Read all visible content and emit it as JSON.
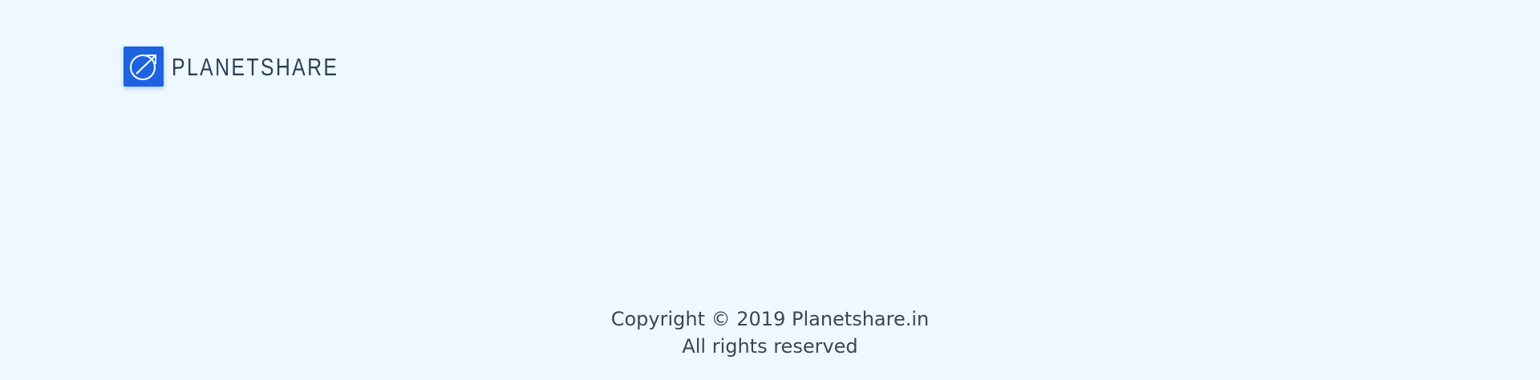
{
  "header": {
    "logo_icon": "share-arrow-icon",
    "brand_name": "PLANETSHARE",
    "brand_color": "#1d63e0"
  },
  "footer": {
    "copyright_prefix": "Copyright © 2019 ",
    "copyright_link": "Planetshare.in",
    "rights": "All rights reserved"
  }
}
